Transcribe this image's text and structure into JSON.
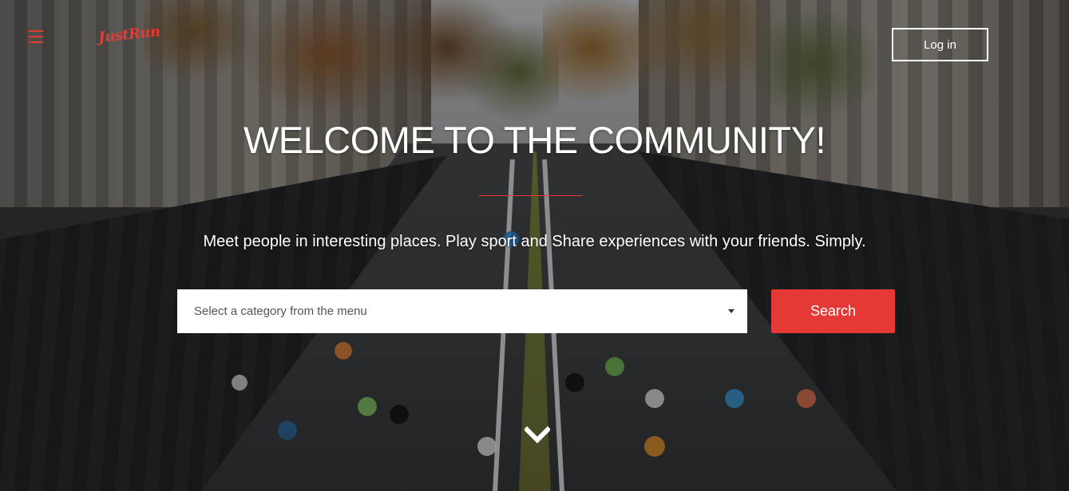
{
  "header": {
    "logo_text": "JustRun",
    "menu_icon": "hamburger-menu-icon",
    "login_label": "Log in"
  },
  "hero": {
    "title": "WELCOME TO THE COMMUNITY!",
    "subtitle": "Meet people in interesting places. Play sport and Share experiences with your friends. Simply.",
    "category_select": {
      "placeholder": "Select a category from the menu",
      "icon": "caret-down-icon"
    },
    "search_label": "Search",
    "scroll_icon": "chevron-down-icon"
  },
  "colors": {
    "accent": "#e53935",
    "text": "#ffffff",
    "select_text": "#555555"
  }
}
